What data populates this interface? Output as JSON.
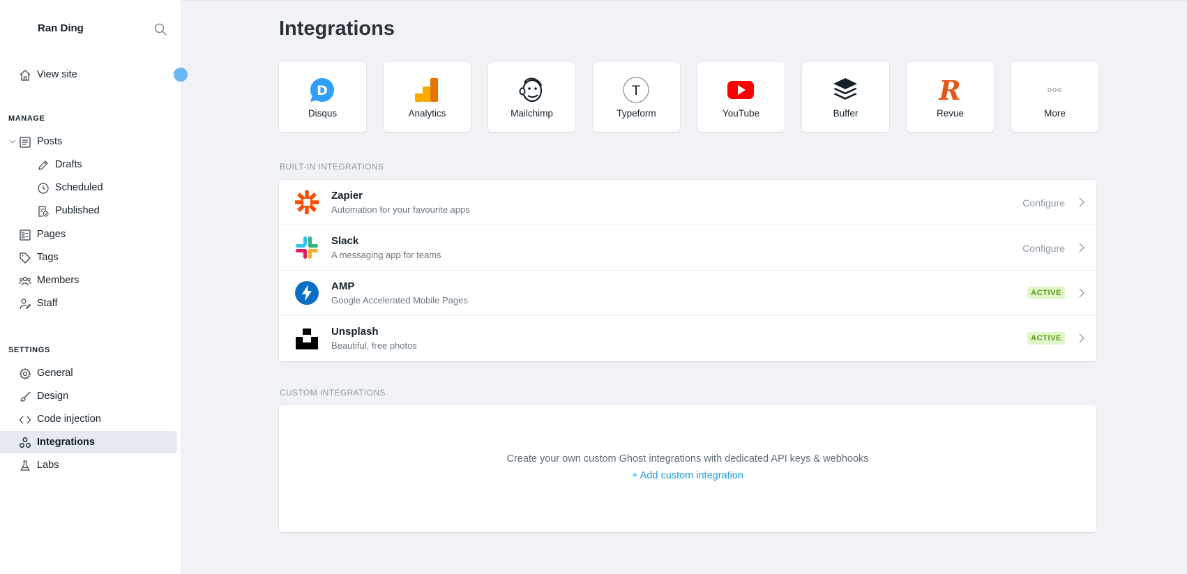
{
  "sidebar": {
    "brand": "Ran Ding",
    "view_site": "View site",
    "manage_title": "MANAGE",
    "posts": "Posts",
    "drafts": "Drafts",
    "scheduled": "Scheduled",
    "published": "Published",
    "pages": "Pages",
    "tags": "Tags",
    "members": "Members",
    "staff": "Staff",
    "settings_title": "SETTINGS",
    "general": "General",
    "design": "Design",
    "code_injection": "Code injection",
    "integrations": "Integrations",
    "labs": "Labs"
  },
  "main": {
    "title": "Integrations",
    "tiles": [
      {
        "label": "Disqus",
        "icon": "disqus-icon"
      },
      {
        "label": "Analytics",
        "icon": "analytics-icon"
      },
      {
        "label": "Mailchimp",
        "icon": "mailchimp-icon"
      },
      {
        "label": "Typeform",
        "icon": "typeform-icon"
      },
      {
        "label": "YouTube",
        "icon": "youtube-icon"
      },
      {
        "label": "Buffer",
        "icon": "buffer-icon"
      },
      {
        "label": "Revue",
        "icon": "revue-icon"
      },
      {
        "label": "More",
        "icon": "more-icon"
      }
    ],
    "builtin_title": "BUILT-IN INTEGRATIONS",
    "builtin": [
      {
        "name": "Zapier",
        "desc": "Automation for your favourite apps",
        "action": "Configure"
      },
      {
        "name": "Slack",
        "desc": "A messaging app for teams",
        "action": "Configure"
      },
      {
        "name": "AMP",
        "desc": "Google Accelerated Mobile Pages",
        "badge": "ACTIVE"
      },
      {
        "name": "Unsplash",
        "desc": "Beautiful, free photos",
        "badge": "ACTIVE"
      }
    ],
    "custom_title": "CUSTOM INTEGRATIONS",
    "custom_text": "Create your own custom Ghost integrations with dedicated API keys & webhooks",
    "custom_add": "+ Add custom integration"
  },
  "colors": {
    "accent": "#1d9be0",
    "active_badge_bg": "#e2f4c9",
    "active_badge_text": "#5a9e16",
    "sidebar_active_bg": "#e5eaf0",
    "page_bg": "#f0f2f5"
  }
}
